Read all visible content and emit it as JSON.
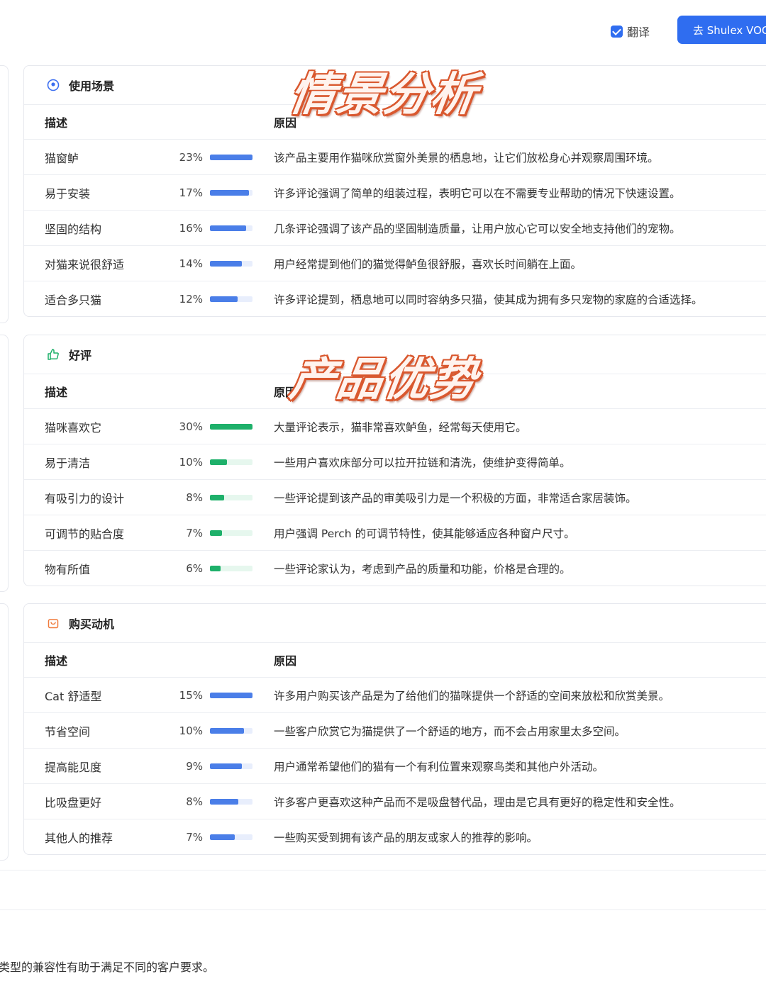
{
  "toolbar": {
    "translate_label": "翻译",
    "voc_button_label": "去 Shulex VOC 查"
  },
  "overlays": {
    "scene_title": "情景分析",
    "advantage_title": "产品优势"
  },
  "columns": {
    "desc": "描述",
    "reason": "原因"
  },
  "sections": [
    {
      "title": "使用场景",
      "icon": "location-pin-icon",
      "rows": [
        {
          "desc": "猫窗鲈",
          "pct": "23%",
          "value": 1.0,
          "reason": "该产品主要用作猫咪欣赏窗外美景的栖息地，让它们放松身心并观察周围环境。"
        },
        {
          "desc": "易于安装",
          "pct": "17%",
          "value": 0.92,
          "reason": "许多评论强调了简单的组装过程，表明它可以在不需要专业帮助的情况下快速设置。"
        },
        {
          "desc": "坚固的结构",
          "pct": "16%",
          "value": 0.85,
          "reason": "几条评论强调了该产品的坚固制造质量，让用户放心它可以安全地支持他们的宠物。"
        },
        {
          "desc": "对猫来说很舒适",
          "pct": "14%",
          "value": 0.75,
          "reason": "用户经常提到他们的猫觉得鲈鱼很舒服，喜欢长时间躺在上面。"
        },
        {
          "desc": "适合多只猫",
          "pct": "12%",
          "value": 0.65,
          "reason": "许多评论提到，栖息地可以同时容纳多只猫，使其成为拥有多只宠物的家庭的合适选择。"
        }
      ]
    },
    {
      "title": "好评",
      "icon": "thumbs-up-icon",
      "rows": [
        {
          "desc": "猫咪喜欢它",
          "pct": "30%",
          "value": 1.0,
          "reason": "大量评论表示，猫非常喜欢鲈鱼，经常每天使用它。"
        },
        {
          "desc": "易于清洁",
          "pct": "10%",
          "value": 0.4,
          "reason": "一些用户喜欢床部分可以拉开拉链和清洗，使维护变得简单。"
        },
        {
          "desc": "有吸引力的设计",
          "pct": "8%",
          "value": 0.33,
          "reason": "一些评论提到该产品的审美吸引力是一个积极的方面，非常适合家居装饰。"
        },
        {
          "desc": "可调节的贴合度",
          "pct": "7%",
          "value": 0.28,
          "reason": "用户强调 Perch 的可调节特性，使其能够适应各种窗户尺寸。"
        },
        {
          "desc": "物有所值",
          "pct": "6%",
          "value": 0.25,
          "reason": "一些评论家认为，考虑到产品的质量和功能，价格是合理的。"
        }
      ]
    },
    {
      "title": "购买动机",
      "icon": "shopping-bag-icon",
      "rows": [
        {
          "desc": "Cat 舒适型",
          "pct": "15%",
          "value": 1.0,
          "reason": "许多用户购买该产品是为了给他们的猫咪提供一个舒适的空间来放松和欣赏美景。"
        },
        {
          "desc": "节省空间",
          "pct": "10%",
          "value": 0.8,
          "reason": "一些客户欣赏它为猫提供了一个舒适的地方，而不会占用家里太多空间。"
        },
        {
          "desc": "提高能见度",
          "pct": "9%",
          "value": 0.75,
          "reason": "用户通常希望他们的猫有一个有利位置来观察鸟类和其他户外活动。"
        },
        {
          "desc": "比吸盘更好",
          "pct": "8%",
          "value": 0.66,
          "reason": "许多客户更喜欢这种产品而不是吸盘替代品，理由是它具有更好的稳定性和安全性。"
        },
        {
          "desc": "其他人的推荐",
          "pct": "7%",
          "value": 0.58,
          "reason": "一些购买受到拥有该产品的朋友或家人的推荐的影响。"
        }
      ]
    }
  ],
  "footer_text": "类型的兼容性有助于满足不同的客户要求。"
}
